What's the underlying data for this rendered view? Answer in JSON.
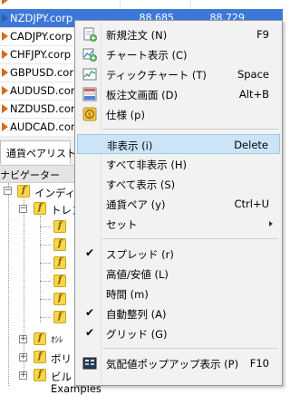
{
  "market_watch": {
    "rows": [
      {
        "symbol": "",
        "bid": "",
        "ask": "",
        "dir": "down",
        "selected": false
      },
      {
        "symbol": "NZDJPY.corp",
        "bid": "88.685",
        "ask": "88.729",
        "dir": "blue",
        "selected": true
      },
      {
        "symbol": "CADJPY.corp",
        "bid": "",
        "ask": "",
        "dir": "down",
        "selected": false
      },
      {
        "symbol": "CHFJPY.corp",
        "bid": "",
        "ask": "",
        "dir": "down",
        "selected": false
      },
      {
        "symbol": "GBPUSD.corp",
        "bid": "",
        "ask": "",
        "dir": "down",
        "selected": false
      },
      {
        "symbol": "AUDUSD.corp",
        "bid": "",
        "ask": "",
        "dir": "down",
        "selected": false
      },
      {
        "symbol": "NZDUSD.corp",
        "bid": "",
        "ask": "",
        "dir": "down",
        "selected": false
      },
      {
        "symbol": "AUDCAD.corp",
        "bid": "",
        "ask": "",
        "dir": "down",
        "selected": false
      }
    ]
  },
  "tabs": {
    "pair_list": "通貨ペアリスト"
  },
  "navigator": {
    "title": "ナビゲーター",
    "indicators_label": "インディケ",
    "trend_label": "トレン",
    "oscillator_label": "ｵｼﾚ",
    "volume_label": "ボリ",
    "bill_label": "ビル",
    "examples_label": "Examples",
    "icon_glyph": "f"
  },
  "context_menu": {
    "items": [
      {
        "label": "新規注文 (N)",
        "shortcut": "F9",
        "icon": "new-order-icon"
      },
      {
        "label": "チャート表示 (C)",
        "shortcut": "",
        "icon": "chart-window-icon"
      },
      {
        "label": "ティックチャート (T)",
        "shortcut": "Space",
        "icon": "tick-chart-icon"
      },
      {
        "label": "板注文画面 (D)",
        "shortcut": "Alt+B",
        "icon": "depth-of-market-icon"
      },
      {
        "label": "仕様 (p)",
        "shortcut": "",
        "icon": "specification-icon"
      },
      {
        "label": "非表示 (i)",
        "shortcut": "Delete",
        "icon": ""
      },
      {
        "label": "すべて非表示 (H)",
        "shortcut": "",
        "icon": ""
      },
      {
        "label": "すべて表示 (S)",
        "shortcut": "",
        "icon": ""
      },
      {
        "label": "通貨ペア (y)",
        "shortcut": "Ctrl+U",
        "icon": ""
      },
      {
        "label": "セット",
        "shortcut": "",
        "icon": ""
      },
      {
        "label": "スプレッド (r)",
        "shortcut": "",
        "icon": "check-icon"
      },
      {
        "label": "高値/安値 (L)",
        "shortcut": "",
        "icon": ""
      },
      {
        "label": "時間 (m)",
        "shortcut": "",
        "icon": ""
      },
      {
        "label": "自動整列 (A)",
        "shortcut": "",
        "icon": "check-icon"
      },
      {
        "label": "グリッド (G)",
        "shortcut": "",
        "icon": "check-icon"
      },
      {
        "label": "気配値ポップアップ表示 (P)",
        "shortcut": "F10",
        "icon": "popup-prices-icon"
      }
    ],
    "check_glyph": "✔"
  },
  "colors": {
    "selection": "#3b78d8",
    "menu_highlight": "#cce4f7",
    "sell_arrow": "#d36a1a",
    "buy_arrow": "#2a62b8"
  }
}
